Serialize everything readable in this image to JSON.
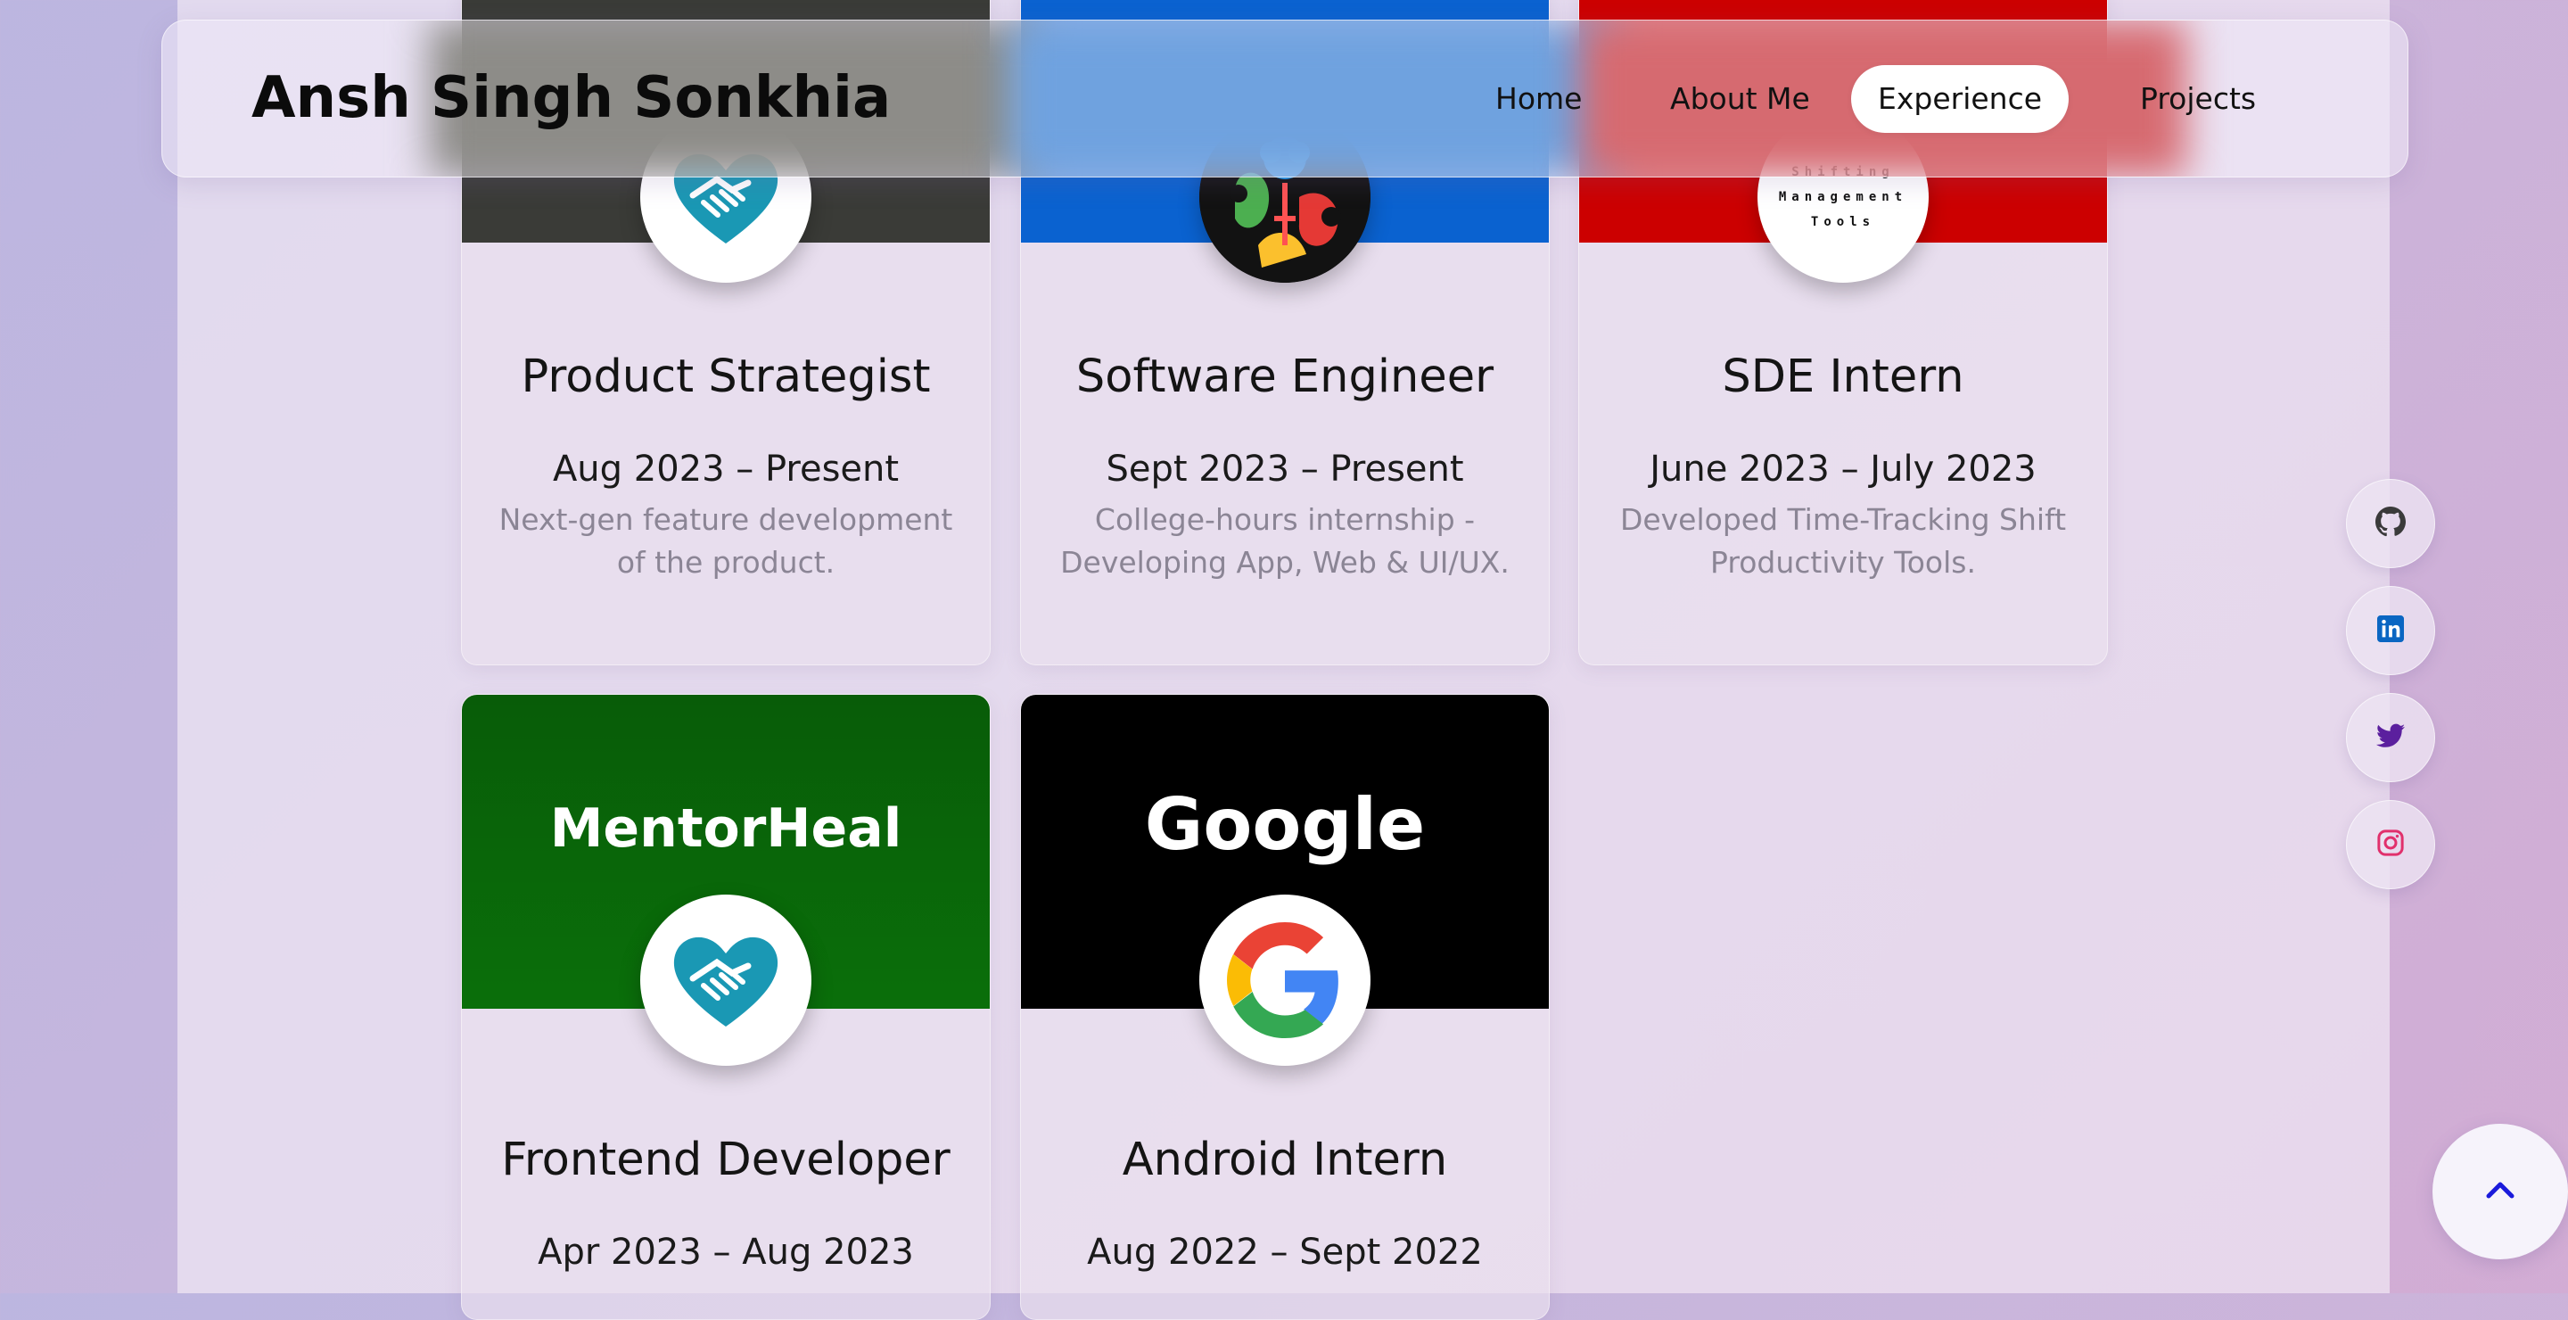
{
  "brand": "Ansh Singh Sonkhia",
  "nav": {
    "items": [
      {
        "label": "Home"
      },
      {
        "label": "About Me"
      },
      {
        "label": "Experience",
        "active": true
      },
      {
        "label": "Projects"
      }
    ]
  },
  "cards": [
    {
      "role": "Product Strategist",
      "dates": "Aug 2023 – Present",
      "desc_line1": "Next-gen feature development",
      "desc_line2": "of the product.",
      "banner_color": "#3a3b37",
      "logo": "handshake-heart-icon"
    },
    {
      "role": "Software Engineer",
      "dates": "Sept 2023 – Present",
      "desc_line1": "College-hours internship -",
      "desc_line2": "Developing App, Web & UI/UX.",
      "banner_color": "#0a62d0",
      "logo": "colorful-figures-logo"
    },
    {
      "role": "SDE Intern",
      "dates": "June 2023 – July 2023",
      "desc_line1": "Developed Time-Tracking Shift",
      "desc_line2": "Productivity Tools.",
      "banner_color": "#cc0000",
      "logo_text_1": "Shifting",
      "logo_text_2": "Management",
      "logo_text_3": "Tools"
    },
    {
      "role": "Frontend Developer",
      "dates": "Apr 2023 – Aug 2023",
      "banner_text": "MentorHeal",
      "banner_color": "#0a6a0a",
      "logo": "handshake-heart-icon"
    },
    {
      "role": "Android Intern",
      "dates": "Aug 2022 – Sept 2022",
      "banner_text": "Google",
      "banner_color": "#000000",
      "logo": "google-g-icon"
    }
  ],
  "social": [
    "github-icon",
    "linkedin-icon",
    "twitter-icon",
    "instagram-icon"
  ],
  "colors": {
    "accent": "#1a1adb",
    "linkedin": "#0a66c2",
    "twitter": "#5b1f9e",
    "instagram": "#e1306c"
  }
}
